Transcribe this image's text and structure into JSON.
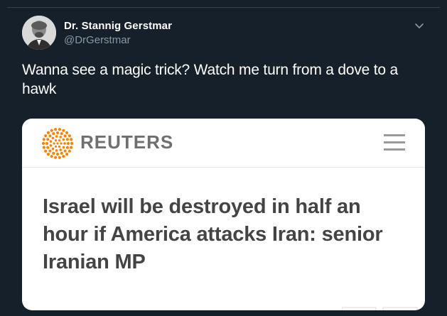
{
  "tweet": {
    "display_name": "Dr. Stannig Gerstmar",
    "handle": "@DrGerstmar",
    "text": "Wanna see a magic trick? Watch me turn from a dove to a hawk",
    "more_icon": "chevron-down-icon"
  },
  "card": {
    "brand": "REUTERS",
    "brand_logo": "reuters-dot-logo",
    "menu_icon": "hamburger-menu-icon",
    "headline": "Israel will be destroyed in half an hour if America attacks Iran: senior Iranian MP",
    "logo_color": "#ff8000"
  },
  "colors": {
    "background": "#15202b",
    "text_primary": "#ffffff",
    "text_secondary": "#8899a6",
    "card_background": "#ffffff",
    "headline_color": "#444444"
  }
}
